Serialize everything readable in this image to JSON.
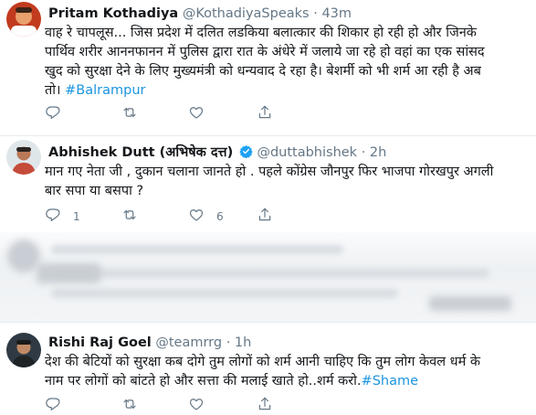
{
  "tweets": [
    {
      "name": "Pritam Kothadiya",
      "handle": "@KothadiyaSpeaks",
      "time": "43m",
      "text_lines": [
        "वाह रे चापलूस... जिस प्रदेश में दलित लडकिया बलात्कार की शिकार हो रही हो और जिनके",
        "पार्थिव शरीर आननफानन में पुलिस द्वारा रात के अंधेरे में जलाये जा रहे हो वहां का एक सांसद",
        "खुद को सुरक्षा देने के लिए मुख्यमंत्री को धन्यवाद दे रहा है। बेशर्मी को भी शर्म आ रही है अब",
        "तो। "
      ],
      "hashtag": "#Balrampur",
      "reply_count": "",
      "retweet_count": "",
      "like_count": ""
    },
    {
      "name": "Abhishek Dutt (अभिषेक दत्त)",
      "handle": "@duttabhishek",
      "time": "2h",
      "verified": true,
      "text_lines": [
        "मान गए नेता जी , दुकान चलाना जानते हो . पहले कोंग्रेस जौनपुर फिर भाजपा गोरखपुर अगली",
        "बार सपा या बसपा ?"
      ],
      "reply_count": "1",
      "retweet_count": "",
      "like_count": "6"
    },
    {
      "name": "Rishi Raj Goel",
      "handle": "@teamrrg",
      "time": "1h",
      "text_lines": [
        "देश की बेटियों को सुरक्षा कब दोगे तुम लोगों को शर्म आनी चाहिए कि तुम लोग केवल धर्म के",
        "नाम पर लोगों को बांटते हो और सत्ता की मलाई खाते हो..शर्म करो."
      ],
      "hashtag": "#Shame",
      "reply_count": "",
      "retweet_count": "",
      "like_count": ""
    }
  ],
  "colors": {
    "text": "#14171a",
    "secondary": "#657786",
    "link": "#1b95e0",
    "verified": "#1da1f2",
    "divider": "#e6ecf0"
  },
  "icons": [
    "reply-icon",
    "retweet-icon",
    "like-icon",
    "share-icon",
    "verified-badge-icon"
  ]
}
